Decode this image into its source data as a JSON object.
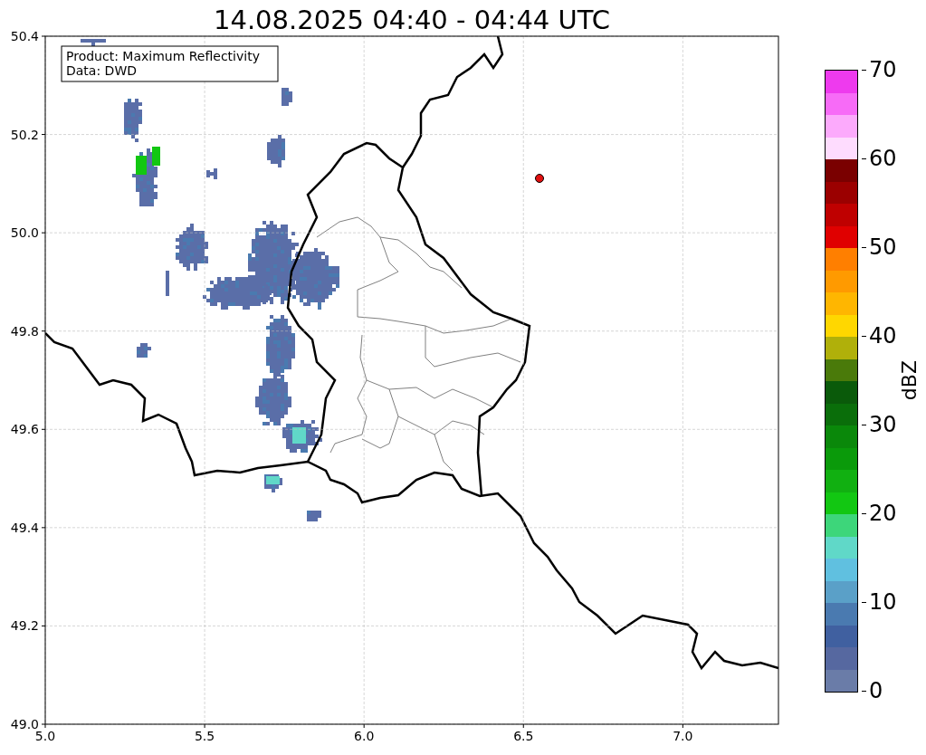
{
  "title": "14.08.2025 04:40 - 04:44 UTC",
  "info_box": {
    "lines": [
      "Product: Maximum Reflectivity",
      "Data: DWD"
    ]
  },
  "x_axis": {
    "ticks": [
      "5.0",
      "5.5",
      "6.0",
      "6.5",
      "7.0"
    ]
  },
  "y_axis": {
    "ticks": [
      "50.4",
      "50.2",
      "50.0",
      "49.8",
      "49.6",
      "49.4",
      "49.2",
      "49.0"
    ]
  },
  "colorbar": {
    "label": "dBZ",
    "ticks": [
      "70",
      "60",
      "50",
      "40",
      "30",
      "20",
      "10",
      "0"
    ],
    "segments": [
      {
        "color": "#ee3aee"
      },
      {
        "color": "#f76bf7"
      },
      {
        "color": "#fcaafc"
      },
      {
        "color": "#fedcfe"
      },
      {
        "color": "#7a0000"
      },
      {
        "color": "#9b0000"
      },
      {
        "color": "#bf0000"
      },
      {
        "color": "#e00000"
      },
      {
        "color": "#ff7f00"
      },
      {
        "color": "#ff9a00"
      },
      {
        "color": "#ffb600"
      },
      {
        "color": "#ffd700"
      },
      {
        "color": "#b0b00a"
      },
      {
        "color": "#4a7a0a"
      },
      {
        "color": "#0a5a0a"
      },
      {
        "color": "#0a6e0a"
      },
      {
        "color": "#0a880a"
      },
      {
        "color": "#0a9a0a"
      },
      {
        "color": "#11b011"
      },
      {
        "color": "#12c712"
      },
      {
        "color": "#3dd67a"
      },
      {
        "color": "#60d8c8"
      },
      {
        "color": "#60c0e0"
      },
      {
        "color": "#5aa0c8"
      },
      {
        "color": "#4a7ab0"
      },
      {
        "color": "#4060a0"
      },
      {
        "color": "#5668a0"
      },
      {
        "color": "#6a7ca8"
      }
    ]
  }
}
